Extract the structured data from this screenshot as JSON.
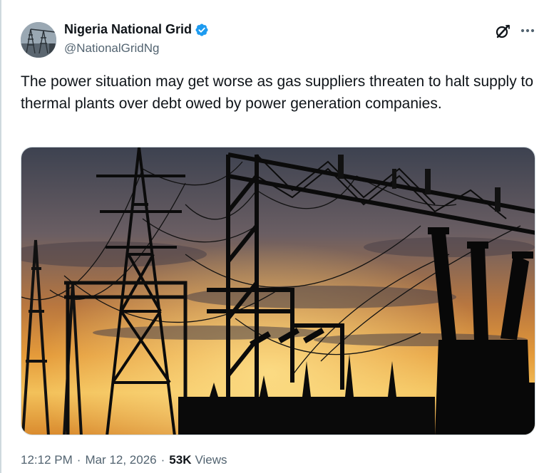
{
  "tweet": {
    "author": {
      "display_name": "Nigeria National Grid",
      "handle": "@NationalGridNg",
      "verified": true
    },
    "text": "The power situation may get worse as gas suppliers threaten to halt supply to thermal plants over debt owed by power generation companies.",
    "time": "12:12 PM",
    "date": "Mar 12, 2026",
    "separator": "·",
    "views_count": "53K",
    "views_label": "Views"
  },
  "icons": {
    "verified": "verified-badge-icon",
    "grok": "grok-icon",
    "more": "more-icon"
  },
  "colors": {
    "text_primary": "#0f1419",
    "text_secondary": "#536471",
    "verified_blue": "#1d9bf0",
    "border": "#cfd9de"
  }
}
